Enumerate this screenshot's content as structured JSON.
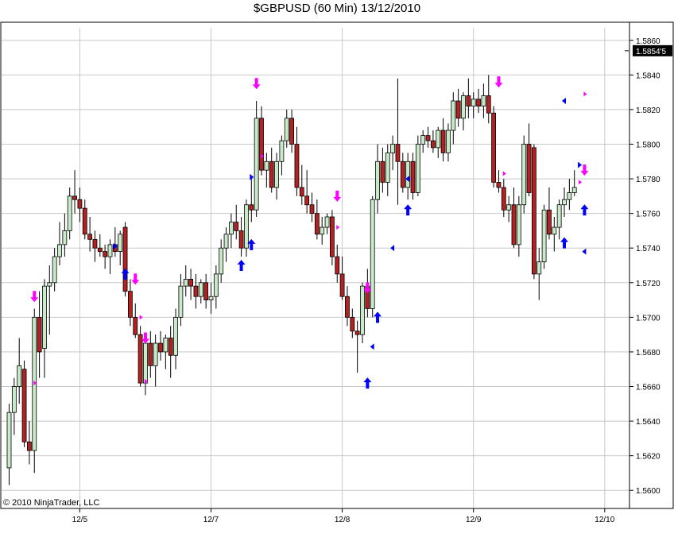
{
  "window": {
    "title": "$GBPUSD (60 Min)  13/12/2010"
  },
  "footer": {
    "copyright": "© 2010 NinjaTrader, LLC"
  },
  "colors": {
    "up_candle": "#c8eac8",
    "down_candle": "#b22222",
    "buy_arrow": "#0000ff",
    "sell_arrow": "#ff00ff",
    "grid": "#c8c8c8",
    "last_price_bg": "#000000"
  },
  "chart_data": {
    "type": "candlestick",
    "title": "$GBPUSD (60 Min)  13/12/2010",
    "ylim": [
      1.559,
      1.587
    ],
    "yticks": [
      "1.5860",
      "1.5840",
      "1.5820",
      "1.5800",
      "1.5780",
      "1.5760",
      "1.5740",
      "1.5720",
      "1.5700",
      "1.5680",
      "1.5660",
      "1.5640",
      "1.5620",
      "1.5600"
    ],
    "ytick_values": [
      1.586,
      1.584,
      1.582,
      1.58,
      1.578,
      1.576,
      1.574,
      1.572,
      1.57,
      1.568,
      1.566,
      1.564,
      1.562,
      1.56
    ],
    "x_labels": [
      "12/5",
      "12/7",
      "12/8",
      "12/9",
      "12/10"
    ],
    "x_label_bar_index": [
      14,
      40,
      66,
      92,
      118
    ],
    "last_price": "1.5854'5",
    "last_price_value": 1.5854,
    "grid": true,
    "candles": [
      [
        1.5613,
        1.565,
        1.5603,
        1.5645
      ],
      [
        1.5645,
        1.5665,
        1.5632,
        1.566
      ],
      [
        1.566,
        1.5688,
        1.565,
        1.5672
      ],
      [
        1.567,
        1.5675,
        1.5625,
        1.5628
      ],
      [
        1.5628,
        1.564,
        1.5615,
        1.5623
      ],
      [
        1.5623,
        1.5705,
        1.561,
        1.57
      ],
      [
        1.57,
        1.5715,
        1.5665,
        1.568
      ],
      [
        1.5682,
        1.5722,
        1.5665,
        1.5718
      ],
      [
        1.5718,
        1.573,
        1.569,
        1.572
      ],
      [
        1.572,
        1.574,
        1.5715,
        1.5735
      ],
      [
        1.5735,
        1.5755,
        1.573,
        1.5742
      ],
      [
        1.5742,
        1.576,
        1.5735,
        1.575
      ],
      [
        1.575,
        1.5775,
        1.5745,
        1.577
      ],
      [
        1.577,
        1.5785,
        1.576,
        1.5768
      ],
      [
        1.5768,
        1.5775,
        1.5755,
        1.5763
      ],
      [
        1.5763,
        1.5768,
        1.5745,
        1.5748
      ],
      [
        1.5748,
        1.5758,
        1.5738,
        1.5745
      ],
      [
        1.5745,
        1.575,
        1.5732,
        1.574
      ],
      [
        1.574,
        1.5748,
        1.5735,
        1.5738
      ],
      [
        1.5738,
        1.5742,
        1.5728,
        1.5735
      ],
      [
        1.5735,
        1.5745,
        1.5725,
        1.5742
      ],
      [
        1.5742,
        1.5752,
        1.5735,
        1.5738
      ],
      [
        1.5738,
        1.575,
        1.573,
        1.5748
      ],
      [
        1.5752,
        1.5755,
        1.5712,
        1.5715
      ],
      [
        1.5715,
        1.5722,
        1.5695,
        1.57
      ],
      [
        1.57,
        1.5708,
        1.5688,
        1.569
      ],
      [
        1.569,
        1.5695,
        1.566,
        1.5662
      ],
      [
        1.5662,
        1.569,
        1.5655,
        1.5685
      ],
      [
        1.5685,
        1.5692,
        1.5665,
        1.5672
      ],
      [
        1.5672,
        1.569,
        1.566,
        1.5685
      ],
      [
        1.5685,
        1.5692,
        1.5675,
        1.568
      ],
      [
        1.568,
        1.569,
        1.567,
        1.5688
      ],
      [
        1.5688,
        1.5695,
        1.5665,
        1.5678
      ],
      [
        1.5678,
        1.5705,
        1.567,
        1.57
      ],
      [
        1.57,
        1.5725,
        1.5695,
        1.5718
      ],
      [
        1.5718,
        1.573,
        1.5712,
        1.5722
      ],
      [
        1.5722,
        1.5728,
        1.571,
        1.5718
      ],
      [
        1.5718,
        1.5725,
        1.5705,
        1.5712
      ],
      [
        1.5712,
        1.5722,
        1.5708,
        1.572
      ],
      [
        1.572,
        1.5725,
        1.5705,
        1.571
      ],
      [
        1.571,
        1.572,
        1.5702,
        1.5712
      ],
      [
        1.5712,
        1.573,
        1.5705,
        1.5725
      ],
      [
        1.5725,
        1.5745,
        1.572,
        1.574
      ],
      [
        1.574,
        1.5752,
        1.5732,
        1.5748
      ],
      [
        1.5748,
        1.576,
        1.574,
        1.5755
      ],
      [
        1.5755,
        1.5765,
        1.5745,
        1.575
      ],
      [
        1.575,
        1.5758,
        1.5735,
        1.574
      ],
      [
        1.574,
        1.5768,
        1.5735,
        1.5765
      ],
      [
        1.5765,
        1.578,
        1.5755,
        1.5762
      ],
      [
        1.5762,
        1.5825,
        1.5758,
        1.5815
      ],
      [
        1.5815,
        1.5822,
        1.5782,
        1.5785
      ],
      [
        1.5785,
        1.5795,
        1.5775,
        1.579
      ],
      [
        1.579,
        1.5798,
        1.5772,
        1.5775
      ],
      [
        1.5775,
        1.5795,
        1.5768,
        1.579
      ],
      [
        1.579,
        1.5805,
        1.5782,
        1.5802
      ],
      [
        1.5802,
        1.582,
        1.5798,
        1.5815
      ],
      [
        1.5815,
        1.582,
        1.5795,
        1.58
      ],
      [
        1.58,
        1.581,
        1.577,
        1.5775
      ],
      [
        1.5775,
        1.5788,
        1.5765,
        1.577
      ],
      [
        1.577,
        1.5785,
        1.576,
        1.5765
      ],
      [
        1.5765,
        1.5772,
        1.5755,
        1.576
      ],
      [
        1.576,
        1.5768,
        1.5745,
        1.5748
      ],
      [
        1.5748,
        1.5758,
        1.5742,
        1.5752
      ],
      [
        1.5752,
        1.576,
        1.5748,
        1.5758
      ],
      [
        1.5758,
        1.5762,
        1.573,
        1.5735
      ],
      [
        1.5735,
        1.5742,
        1.572,
        1.5725
      ],
      [
        1.5725,
        1.5735,
        1.571,
        1.5712
      ],
      [
        1.5712,
        1.5718,
        1.5695,
        1.57
      ],
      [
        1.57,
        1.5705,
        1.5688,
        1.5692
      ],
      [
        1.5692,
        1.5698,
        1.5668,
        1.569
      ],
      [
        1.569,
        1.572,
        1.5685,
        1.5718
      ],
      [
        1.5718,
        1.5728,
        1.57,
        1.5705
      ],
      [
        1.5705,
        1.577,
        1.57,
        1.5768
      ],
      [
        1.5768,
        1.58,
        1.576,
        1.579
      ],
      [
        1.579,
        1.5798,
        1.5772,
        1.5778
      ],
      [
        1.5778,
        1.58,
        1.577,
        1.5795
      ],
      [
        1.5795,
        1.5805,
        1.5785,
        1.58
      ],
      [
        1.58,
        1.5838,
        1.5765,
        1.579
      ],
      [
        1.579,
        1.5795,
        1.5772,
        1.5775
      ],
      [
        1.5775,
        1.5795,
        1.5768,
        1.579
      ],
      [
        1.579,
        1.5795,
        1.5768,
        1.5772
      ],
      [
        1.5772,
        1.5805,
        1.577,
        1.58
      ],
      [
        1.58,
        1.5808,
        1.5795,
        1.5805
      ],
      [
        1.5805,
        1.581,
        1.5798,
        1.5802
      ],
      [
        1.5802,
        1.5808,
        1.5795,
        1.5798
      ],
      [
        1.5798,
        1.581,
        1.5792,
        1.5808
      ],
      [
        1.5808,
        1.5815,
        1.579,
        1.5795
      ],
      [
        1.5795,
        1.5812,
        1.579,
        1.5808
      ],
      [
        1.5808,
        1.583,
        1.58,
        1.5825
      ],
      [
        1.5825,
        1.5832,
        1.581,
        1.5815
      ],
      [
        1.5815,
        1.583,
        1.5808,
        1.5828
      ],
      [
        1.5828,
        1.5838,
        1.5815,
        1.5822
      ],
      [
        1.5822,
        1.583,
        1.5815,
        1.5826
      ],
      [
        1.5826,
        1.5832,
        1.5818,
        1.5822
      ],
      [
        1.5822,
        1.5835,
        1.5815,
        1.5828
      ],
      [
        1.5828,
        1.584,
        1.5812,
        1.5818
      ],
      [
        1.5818,
        1.5822,
        1.5775,
        1.5778
      ],
      [
        1.5778,
        1.5785,
        1.5772,
        1.5775
      ],
      [
        1.5775,
        1.578,
        1.5758,
        1.5762
      ],
      [
        1.5762,
        1.577,
        1.5755,
        1.5765
      ],
      [
        1.5765,
        1.5775,
        1.574,
        1.5742
      ],
      [
        1.5742,
        1.577,
        1.5735,
        1.5765
      ],
      [
        1.5765,
        1.5805,
        1.576,
        1.58
      ],
      [
        1.58,
        1.5812,
        1.577,
        1.5772
      ],
      [
        1.5798,
        1.58,
        1.5722,
        1.5725
      ],
      [
        1.5725,
        1.574,
        1.571,
        1.5732
      ],
      [
        1.5732,
        1.5765,
        1.5728,
        1.5762
      ],
      [
        1.5762,
        1.5775,
        1.5745,
        1.5748
      ],
      [
        1.5748,
        1.5758,
        1.5738,
        1.5752
      ],
      [
        1.5752,
        1.5768,
        1.5745,
        1.5765
      ],
      [
        1.5765,
        1.5775,
        1.5758,
        1.5768
      ],
      [
        1.5768,
        1.578,
        1.5762,
        1.5772
      ],
      [
        1.5772,
        1.5785,
        1.577,
        1.5775
      ]
    ],
    "buy_signals": [
      {
        "bar": 23,
        "value": 1.5725
      },
      {
        "bar": 46,
        "value": 1.573
      },
      {
        "bar": 48,
        "value": 1.5742
      },
      {
        "bar": 71,
        "value": 1.5662
      },
      {
        "bar": 73,
        "value": 1.57
      },
      {
        "bar": 79,
        "value": 1.5762
      },
      {
        "bar": 110,
        "value": 1.5743
      },
      {
        "bar": 114,
        "value": 1.5762
      }
    ],
    "sell_signals": [
      {
        "bar": 5,
        "value": 1.5712
      },
      {
        "bar": 25,
        "value": 1.5722
      },
      {
        "bar": 27,
        "value": 1.5688
      },
      {
        "bar": 49,
        "value": 1.5835
      },
      {
        "bar": 65,
        "value": 1.577
      },
      {
        "bar": 71,
        "value": 1.5717
      },
      {
        "bar": 97,
        "value": 1.5836
      },
      {
        "bar": 114,
        "value": 1.5785
      }
    ],
    "left_triangles": [
      {
        "bar": 72,
        "value": 1.5683
      },
      {
        "bar": 76,
        "value": 1.574
      },
      {
        "bar": 79,
        "value": 1.578
      },
      {
        "bar": 110,
        "value": 1.5825
      },
      {
        "bar": 114,
        "value": 1.5738
      }
    ],
    "right_triangles": [
      {
        "bar": 21,
        "value": 1.5741
      },
      {
        "bar": 48,
        "value": 1.5781
      },
      {
        "bar": 113,
        "value": 1.5788
      }
    ],
    "small_markers": [
      {
        "bar": 5,
        "value": 1.5662
      },
      {
        "bar": 26,
        "value": 1.57
      },
      {
        "bar": 27,
        "value": 1.5663
      },
      {
        "bar": 50,
        "value": 1.5793
      },
      {
        "bar": 65,
        "value": 1.5752
      },
      {
        "bar": 98,
        "value": 1.5783
      },
      {
        "bar": 113,
        "value": 1.5778
      },
      {
        "bar": 114,
        "value": 1.5829
      }
    ]
  }
}
